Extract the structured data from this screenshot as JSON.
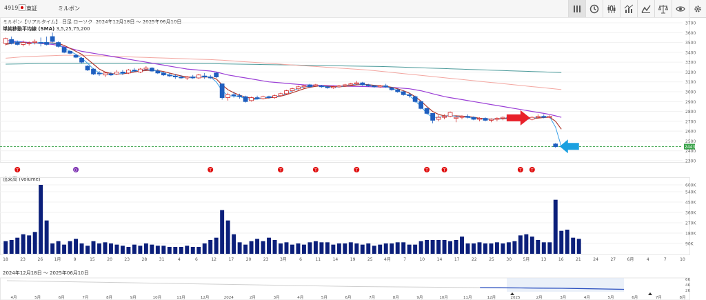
{
  "header": {
    "code": "4919",
    "exchange": "東証",
    "name": "ミルボン",
    "subtitle": "ミルボン【リアルタイム】 日足 ローソク",
    "date_range": "2024年12月18日 ～ 2025年06月10日",
    "indicator_label": "単純移動平均線 (SMA)",
    "indicator_params": "3,5,25,75,200"
  },
  "toolbar": {
    "icons": [
      "chart-type-icon",
      "clock-icon",
      "candlestick-icon",
      "indicator-icon",
      "compare-icon",
      "scale-icon",
      "eye-icon",
      "gear-icon"
    ]
  },
  "volume_label": "出来高 (Volume)",
  "navigator": {
    "range_label": "2024年12月18日 ～ 2025年06月10日",
    "x_labels": [
      "4月",
      "5月",
      "6月",
      "7月",
      "8月",
      "9月",
      "10月",
      "11月",
      "12月",
      "2024",
      "2月",
      "3月",
      "4月",
      "5月",
      "6月",
      "7月",
      "8月",
      "9月",
      "10月",
      "11月",
      "12月",
      "2025",
      "2月",
      "3月",
      "4月",
      "5月",
      "6月",
      "7月",
      "8月"
    ],
    "y_labels": [
      "6K",
      "4K",
      "2K"
    ]
  },
  "colors": {
    "up": "#d22727",
    "down": "#1f5fbf",
    "sma3": "#3aa0e8",
    "sma5": "#b03a2e",
    "sma25": "#9b3fd6",
    "sma75": "#f3a6a0",
    "sma200": "#4a9a9a",
    "volume": "#0b1f7a",
    "last_price_bg": "#3aa34a"
  },
  "price_axis_labels": [
    "3700",
    "3600",
    "3500",
    "3400",
    "3300",
    "3200",
    "3100",
    "3000",
    "2900",
    "2800",
    "2700",
    "2600",
    "2500",
    "2400",
    "2300"
  ],
  "last_price_label": "2443",
  "volume_axis_labels": [
    "600K",
    "540K",
    "450K",
    "360K",
    "270K",
    "180K",
    "90K"
  ],
  "x_axis_labels": [
    "18",
    "23",
    "26",
    "1月",
    "9",
    "15",
    "20",
    "23",
    "28",
    "31",
    "4",
    "6",
    "12",
    "17",
    "20",
    "23",
    "3月",
    "6",
    "11",
    "14",
    "19",
    "25",
    "4月",
    "7",
    "10",
    "14",
    "17",
    "22",
    "25",
    "30",
    "5月",
    "13",
    "16",
    "21",
    "24",
    "27",
    "6月",
    "4",
    "7",
    "10"
  ],
  "event_markers": [
    "T",
    "D",
    "T",
    "T",
    "T",
    "T",
    "T",
    "T",
    "T",
    "T"
  ],
  "chart_data": {
    "type": "candlestick",
    "title": "",
    "ylim": [
      2300,
      3700
    ],
    "volume_ylim": [
      0,
      630000
    ],
    "candles": [
      {
        "o": 3490,
        "h": 3550,
        "l": 3470,
        "c": 3540
      },
      {
        "o": 3530,
        "h": 3560,
        "l": 3480,
        "c": 3490
      },
      {
        "o": 3500,
        "h": 3520,
        "l": 3470,
        "c": 3480
      },
      {
        "o": 3480,
        "h": 3520,
        "l": 3460,
        "c": 3500
      },
      {
        "o": 3490,
        "h": 3510,
        "l": 3470,
        "c": 3495
      },
      {
        "o": 3500,
        "h": 3530,
        "l": 3480,
        "c": 3510
      },
      {
        "o": 3500,
        "h": 3550,
        "l": 3460,
        "c": 3490
      },
      {
        "o": 3500,
        "h": 3560,
        "l": 3470,
        "c": 3480
      },
      {
        "o": 3560,
        "h": 3600,
        "l": 3500,
        "c": 3510
      },
      {
        "o": 3500,
        "h": 3510,
        "l": 3450,
        "c": 3460
      },
      {
        "o": 3450,
        "h": 3460,
        "l": 3390,
        "c": 3400
      },
      {
        "o": 3410,
        "h": 3430,
        "l": 3380,
        "c": 3390
      },
      {
        "o": 3370,
        "h": 3380,
        "l": 3340,
        "c": 3350
      },
      {
        "o": 3340,
        "h": 3350,
        "l": 3290,
        "c": 3300
      },
      {
        "o": 3260,
        "h": 3270,
        "l": 3210,
        "c": 3220
      },
      {
        "o": 3230,
        "h": 3240,
        "l": 3170,
        "c": 3180
      },
      {
        "o": 3190,
        "h": 3210,
        "l": 3160,
        "c": 3180
      },
      {
        "o": 3170,
        "h": 3200,
        "l": 3150,
        "c": 3190
      },
      {
        "o": 3180,
        "h": 3200,
        "l": 3160,
        "c": 3170
      },
      {
        "o": 3180,
        "h": 3220,
        "l": 3170,
        "c": 3200
      },
      {
        "o": 3200,
        "h": 3220,
        "l": 3170,
        "c": 3190
      },
      {
        "o": 3190,
        "h": 3230,
        "l": 3180,
        "c": 3220
      },
      {
        "o": 3220,
        "h": 3240,
        "l": 3200,
        "c": 3210
      },
      {
        "o": 3200,
        "h": 3240,
        "l": 3190,
        "c": 3230
      },
      {
        "o": 3230,
        "h": 3260,
        "l": 3210,
        "c": 3240
      },
      {
        "o": 3240,
        "h": 3250,
        "l": 3200,
        "c": 3210
      },
      {
        "o": 3210,
        "h": 3230,
        "l": 3180,
        "c": 3190
      },
      {
        "o": 3190,
        "h": 3200,
        "l": 3160,
        "c": 3170
      },
      {
        "o": 3170,
        "h": 3190,
        "l": 3150,
        "c": 3160
      },
      {
        "o": 3160,
        "h": 3180,
        "l": 3130,
        "c": 3150
      },
      {
        "o": 3150,
        "h": 3170,
        "l": 3130,
        "c": 3140
      },
      {
        "o": 3140,
        "h": 3160,
        "l": 3120,
        "c": 3150
      },
      {
        "o": 3150,
        "h": 3170,
        "l": 3130,
        "c": 3140
      },
      {
        "o": 3140,
        "h": 3180,
        "l": 3130,
        "c": 3170
      },
      {
        "o": 3160,
        "h": 3190,
        "l": 3130,
        "c": 3150
      },
      {
        "o": 3150,
        "h": 3170,
        "l": 3130,
        "c": 3140
      },
      {
        "o": 3190,
        "h": 3200,
        "l": 3140,
        "c": 3150
      },
      {
        "o": 3080,
        "h": 3080,
        "l": 2920,
        "c": 2940
      },
      {
        "o": 2940,
        "h": 2990,
        "l": 2910,
        "c": 2970
      },
      {
        "o": 2970,
        "h": 3000,
        "l": 2940,
        "c": 2960
      },
      {
        "o": 2960,
        "h": 2980,
        "l": 2930,
        "c": 2950
      },
      {
        "o": 2950,
        "h": 2960,
        "l": 2890,
        "c": 2900
      },
      {
        "o": 2910,
        "h": 2950,
        "l": 2900,
        "c": 2940
      },
      {
        "o": 2940,
        "h": 2960,
        "l": 2920,
        "c": 2930
      },
      {
        "o": 2930,
        "h": 2960,
        "l": 2920,
        "c": 2950
      },
      {
        "o": 2950,
        "h": 2960,
        "l": 2930,
        "c": 2940
      },
      {
        "o": 2940,
        "h": 2970,
        "l": 2930,
        "c": 2960
      },
      {
        "o": 2960,
        "h": 2990,
        "l": 2950,
        "c": 2980
      },
      {
        "o": 2980,
        "h": 3020,
        "l": 2970,
        "c": 3010
      },
      {
        "o": 3010,
        "h": 3040,
        "l": 3000,
        "c": 3030
      },
      {
        "o": 3030,
        "h": 3060,
        "l": 3020,
        "c": 3050
      },
      {
        "o": 3050,
        "h": 3070,
        "l": 3030,
        "c": 3060
      },
      {
        "o": 3070,
        "h": 3080,
        "l": 3040,
        "c": 3050
      },
      {
        "o": 3060,
        "h": 3080,
        "l": 3050,
        "c": 3070
      },
      {
        "o": 3060,
        "h": 3070,
        "l": 3040,
        "c": 3050
      },
      {
        "o": 3050,
        "h": 3060,
        "l": 3030,
        "c": 3040
      },
      {
        "o": 3040,
        "h": 3060,
        "l": 3030,
        "c": 3050
      },
      {
        "o": 3050,
        "h": 3070,
        "l": 3040,
        "c": 3060
      },
      {
        "o": 3060,
        "h": 3080,
        "l": 3050,
        "c": 3070
      },
      {
        "o": 3070,
        "h": 3090,
        "l": 3060,
        "c": 3080
      },
      {
        "o": 3080,
        "h": 3110,
        "l": 3070,
        "c": 3090
      },
      {
        "o": 3090,
        "h": 3100,
        "l": 3060,
        "c": 3070
      },
      {
        "o": 3070,
        "h": 3080,
        "l": 3050,
        "c": 3060
      },
      {
        "o": 3060,
        "h": 3070,
        "l": 3040,
        "c": 3050
      },
      {
        "o": 3050,
        "h": 3070,
        "l": 3040,
        "c": 3060
      },
      {
        "o": 3060,
        "h": 3080,
        "l": 3040,
        "c": 3050
      },
      {
        "o": 3040,
        "h": 3050,
        "l": 3010,
        "c": 3020
      },
      {
        "o": 3020,
        "h": 3030,
        "l": 2990,
        "c": 3000
      },
      {
        "o": 3000,
        "h": 3010,
        "l": 2960,
        "c": 2970
      },
      {
        "o": 2970,
        "h": 2990,
        "l": 2940,
        "c": 2960
      },
      {
        "o": 2950,
        "h": 2960,
        "l": 2890,
        "c": 2900
      },
      {
        "o": 2900,
        "h": 2910,
        "l": 2820,
        "c": 2830
      },
      {
        "o": 2830,
        "h": 2840,
        "l": 2770,
        "c": 2780
      },
      {
        "o": 2780,
        "h": 2780,
        "l": 2680,
        "c": 2710
      },
      {
        "o": 2720,
        "h": 2760,
        "l": 2700,
        "c": 2740
      },
      {
        "o": 2740,
        "h": 2770,
        "l": 2720,
        "c": 2750
      },
      {
        "o": 2750,
        "h": 2800,
        "l": 2740,
        "c": 2790
      },
      {
        "o": 2730,
        "h": 2760,
        "l": 2690,
        "c": 2740
      },
      {
        "o": 2740,
        "h": 2760,
        "l": 2720,
        "c": 2750
      },
      {
        "o": 2750,
        "h": 2770,
        "l": 2730,
        "c": 2740
      },
      {
        "o": 2740,
        "h": 2750,
        "l": 2710,
        "c": 2720
      },
      {
        "o": 2720,
        "h": 2740,
        "l": 2700,
        "c": 2730
      },
      {
        "o": 2730,
        "h": 2740,
        "l": 2700,
        "c": 2710
      },
      {
        "o": 2710,
        "h": 2730,
        "l": 2690,
        "c": 2720
      },
      {
        "o": 2720,
        "h": 2740,
        "l": 2700,
        "c": 2730
      },
      {
        "o": 2730,
        "h": 2750,
        "l": 2710,
        "c": 2740
      },
      {
        "o": 2740,
        "h": 2750,
        "l": 2720,
        "c": 2730
      },
      {
        "o": 2730,
        "h": 2750,
        "l": 2710,
        "c": 2720
      },
      {
        "o": 2720,
        "h": 2740,
        "l": 2710,
        "c": 2730
      },
      {
        "o": 2730,
        "h": 2740,
        "l": 2710,
        "c": 2720
      },
      {
        "o": 2720,
        "h": 2750,
        "l": 2710,
        "c": 2740
      },
      {
        "o": 2740,
        "h": 2770,
        "l": 2730,
        "c": 2750
      },
      {
        "o": 2750,
        "h": 2770,
        "l": 2730,
        "c": 2740
      },
      {
        "o": 2740,
        "h": 2760,
        "l": 2730,
        "c": 2750
      },
      {
        "o": 2470,
        "h": 2480,
        "l": 2430,
        "c": 2443
      }
    ],
    "volume": [
      110000,
      120000,
      140000,
      170000,
      160000,
      190000,
      600000,
      290000,
      90000,
      110000,
      80000,
      110000,
      130000,
      90000,
      70000,
      110000,
      90000,
      100000,
      90000,
      80000,
      70000,
      60000,
      80000,
      70000,
      90000,
      80000,
      70000,
      70000,
      60000,
      60000,
      60000,
      70000,
      60000,
      60000,
      90000,
      120000,
      140000,
      380000,
      290000,
      170000,
      100000,
      80000,
      110000,
      130000,
      110000,
      140000,
      120000,
      90000,
      100000,
      80000,
      90000,
      80000,
      100000,
      110000,
      100000,
      100000,
      80000,
      90000,
      90000,
      100000,
      90000,
      80000,
      90000,
      70000,
      80000,
      90000,
      90000,
      100000,
      100000,
      80000,
      80000,
      110000,
      120000,
      120000,
      120000,
      120000,
      110000,
      120000,
      150000,
      90000,
      90000,
      100000,
      90000,
      90000,
      100000,
      90000,
      100000,
      110000,
      160000,
      170000,
      150000,
      120000,
      100000,
      100000,
      470000,
      200000,
      210000,
      140000,
      130000
    ],
    "sma3": [
      3490,
      3500,
      3510,
      3500,
      3490,
      3495,
      3500,
      3500,
      3490,
      3480,
      3440,
      3410,
      3380,
      3340,
      3290,
      3230,
      3190,
      3180,
      3180,
      3180,
      3185,
      3200,
      3210,
      3215,
      3225,
      3220,
      3210,
      3190,
      3170,
      3155,
      3145,
      3145,
      3145,
      3150,
      3155,
      3150,
      3100,
      3010,
      2960,
      2955,
      2950,
      2930,
      2920,
      2925,
      2935,
      2945,
      2950,
      2960,
      2980,
      3010,
      3030,
      3050,
      3055,
      3060,
      3055,
      3050,
      3045,
      3050,
      3060,
      3070,
      3080,
      3075,
      3065,
      3055,
      3055,
      3050,
      3035,
      3010,
      2985,
      2960,
      2910,
      2850,
      2780,
      2740,
      2740,
      2750,
      2760,
      2750,
      2745,
      2740,
      2730,
      2725,
      2720,
      2720,
      2725,
      2730,
      2735,
      2730,
      2725,
      2725,
      2730,
      2740,
      2745,
      2745,
      2640,
      2443
    ],
    "sma5": [
      3480,
      3490,
      3500,
      3500,
      3495,
      3495,
      3495,
      3498,
      3495,
      3490,
      3470,
      3440,
      3410,
      3380,
      3330,
      3280,
      3230,
      3200,
      3185,
      3180,
      3182,
      3190,
      3200,
      3210,
      3215,
      3218,
      3215,
      3205,
      3190,
      3175,
      3160,
      3150,
      3148,
      3148,
      3150,
      3150,
      3130,
      3070,
      3020,
      2990,
      2965,
      2945,
      2935,
      2930,
      2932,
      2938,
      2945,
      2955,
      2970,
      2990,
      3010,
      3030,
      3045,
      3055,
      3058,
      3055,
      3052,
      3050,
      3055,
      3060,
      3070,
      3075,
      3072,
      3065,
      3060,
      3055,
      3045,
      3030,
      3010,
      2985,
      2950,
      2905,
      2850,
      2800,
      2770,
      2755,
      2755,
      2755,
      2752,
      2748,
      2740,
      2732,
      2725,
      2722,
      2722,
      2725,
      2728,
      2730,
      2728,
      2726,
      2728,
      2732,
      2738,
      2742,
      2700,
      2620
    ],
    "sma25": [
      3520,
      3515,
      3510,
      3505,
      3500,
      3495,
      3490,
      3485,
      3480,
      3470,
      3455,
      3440,
      3425,
      3410,
      3400,
      3390,
      3380,
      3370,
      3360,
      3350,
      3340,
      3330,
      3320,
      3310,
      3300,
      3290,
      3280,
      3270,
      3260,
      3250,
      3240,
      3230,
      3225,
      3220,
      3215,
      3210,
      3200,
      3185,
      3170,
      3160,
      3150,
      3140,
      3130,
      3120,
      3110,
      3100,
      3095,
      3090,
      3085,
      3080,
      3075,
      3070,
      3068,
      3066,
      3064,
      3062,
      3060,
      3058,
      3056,
      3055,
      3054,
      3053,
      3052,
      3050,
      3048,
      3046,
      3044,
      3040,
      3035,
      3030,
      3020,
      3010,
      2995,
      2980,
      2965,
      2950,
      2940,
      2930,
      2920,
      2910,
      2900,
      2890,
      2880,
      2870,
      2860,
      2850,
      2840,
      2830,
      2820,
      2810,
      2800,
      2790,
      2780,
      2770,
      2755,
      2740
    ],
    "sma75": [
      3340,
      3345,
      3350,
      3355,
      3358,
      3360,
      3362,
      3364,
      3366,
      3368,
      3370,
      3370,
      3370,
      3370,
      3368,
      3366,
      3364,
      3362,
      3360,
      3358,
      3356,
      3354,
      3352,
      3350,
      3348,
      3346,
      3344,
      3342,
      3340,
      3338,
      3336,
      3334,
      3332,
      3330,
      3328,
      3326,
      3323,
      3320,
      3316,
      3312,
      3308,
      3304,
      3300,
      3296,
      3292,
      3288,
      3284,
      3280,
      3276,
      3272,
      3268,
      3264,
      3260,
      3256,
      3252,
      3248,
      3244,
      3240,
      3236,
      3232,
      3228,
      3224,
      3220,
      3214,
      3208,
      3202,
      3196,
      3190,
      3184,
      3178,
      3172,
      3166,
      3160,
      3154,
      3148,
      3142,
      3136,
      3130,
      3124,
      3118,
      3112,
      3106,
      3100,
      3094,
      3088,
      3082,
      3076,
      3070,
      3064,
      3058,
      3052,
      3046,
      3040,
      3034,
      3028,
      3022
    ],
    "sma200": [
      3280,
      3281,
      3282,
      3283,
      3284,
      3285,
      3286,
      3286,
      3286,
      3286,
      3286,
      3286,
      3286,
      3286,
      3286,
      3286,
      3286,
      3286,
      3286,
      3286,
      3286,
      3286,
      3286,
      3286,
      3286,
      3286,
      3286,
      3286,
      3286,
      3286,
      3286,
      3286,
      3286,
      3286,
      3285,
      3285,
      3284,
      3283,
      3282,
      3281,
      3280,
      3279,
      3278,
      3277,
      3276,
      3275,
      3274,
      3273,
      3272,
      3271,
      3270,
      3269,
      3268,
      3267,
      3266,
      3265,
      3264,
      3263,
      3262,
      3261,
      3260,
      3259,
      3258,
      3257,
      3256,
      3255,
      3253,
      3251,
      3249,
      3247,
      3245,
      3243,
      3241,
      3239,
      3237,
      3235,
      3233,
      3231,
      3229,
      3227,
      3225,
      3223,
      3221,
      3219,
      3217,
      3215,
      3213,
      3211,
      3209,
      3207,
      3205,
      3203,
      3201,
      3199,
      3197,
      3195
    ],
    "navigator_line": [
      5200,
      5100,
      5000,
      4900,
      4800,
      4700,
      4600,
      4500,
      4400,
      4300,
      4200,
      4100,
      4000,
      3900,
      3800,
      3700,
      3600,
      3500,
      3450,
      3400,
      3350,
      3300,
      3250,
      3200,
      3150,
      3100,
      3050,
      3000,
      2900,
      2800,
      2700
    ]
  }
}
